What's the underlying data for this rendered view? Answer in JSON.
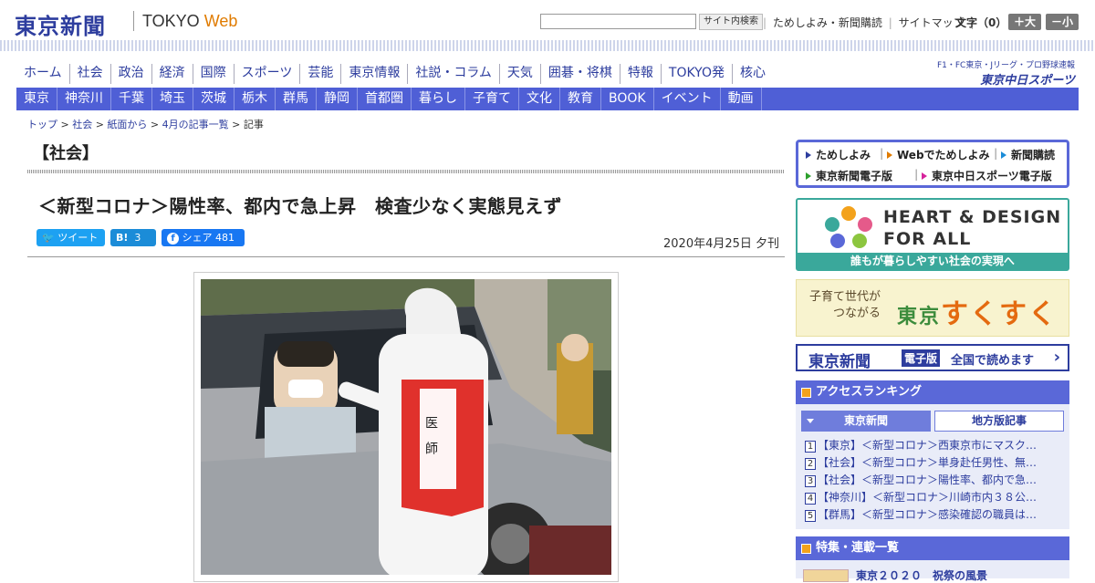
{
  "site": {
    "logo": "東京新聞",
    "web_brand": "TOKYO",
    "web_brand_accent": "Web"
  },
  "header": {
    "search_button": "サイト内検索",
    "links": [
      "ためしよみ・新聞購読",
      "サイトマップ"
    ],
    "font_size_label": "文字（0）",
    "font_bigger": "＋大",
    "font_smaller": "－小"
  },
  "nav_primary": [
    "ホーム",
    "社会",
    "政治",
    "経済",
    "国際",
    "スポーツ",
    "芸能",
    "東京情報",
    "社説・コラム",
    "天気",
    "囲碁・将棋",
    "特報",
    "TOKYO発",
    "核心"
  ],
  "chunichi": {
    "small": "F1・FC東京・Jリーグ・プロ野球速報",
    "big": "東京中日スポーツ"
  },
  "nav_regions": [
    "東京",
    "神奈川",
    "千葉",
    "埼玉",
    "茨城",
    "栃木",
    "群馬",
    "静岡",
    "首都圏",
    "暮らし",
    "子育て",
    "文化",
    "教育",
    "BOOK",
    "イベント",
    "動画"
  ],
  "breadcrumb": {
    "items": [
      "トップ",
      "社会",
      "紙面から",
      "4月の記事一覧",
      "記事"
    ],
    "separator": " > "
  },
  "article": {
    "section": "【社会】",
    "headline": "＜新型コロナ＞陽性率、都内で急上昇　検査少なく実態見えず",
    "date": "2020年4月25日 夕刊",
    "share": {
      "tweet": "ツイート",
      "hatena_label": "B!",
      "hatena_count": "3",
      "facebook": "シェア",
      "facebook_count": "481"
    },
    "photo_vest_text": "医　師"
  },
  "sidebar": {
    "promo": {
      "trial": "ためしよみ",
      "web_trial": "Webでためしよみ",
      "subscribe": "新聞購読",
      "e_edition": "東京新聞電子版",
      "chunichi_e": "東京中日スポーツ電子版"
    },
    "heart": {
      "line1": "HEART & DESIGN",
      "line2": "FOR ALL",
      "bar": "誰もが暮らしやすい社会の実現へ"
    },
    "kosodate": {
      "line1": "子育て世代が",
      "line2": "つながる",
      "brand_tokyo": "東京",
      "brand": "すくすく"
    },
    "denshi": {
      "name": "東京新聞",
      "badge": "電子版",
      "text": "全国で読めます",
      "chevron": "›"
    },
    "ranking": {
      "title": "アクセスランキング",
      "tab_active": "東京新聞",
      "tab_other": "地方版記事",
      "items": [
        {
          "num": "1",
          "text": "【東京】＜新型コロナ＞西東京市にマスク…"
        },
        {
          "num": "2",
          "text": "【社会】＜新型コロナ＞単身赴任男性、無…"
        },
        {
          "num": "3",
          "text": "【社会】＜新型コロナ＞陽性率、都内で急…"
        },
        {
          "num": "4",
          "text": "【神奈川】＜新型コロナ＞川崎市内３８公…"
        },
        {
          "num": "5",
          "text": "【群馬】＜新型コロナ＞感染確認の職員は…"
        }
      ]
    },
    "features": {
      "title": "特集・連載一覧",
      "first": "東京２０２０　祝祭の風景"
    }
  },
  "colors": {
    "brand_blue": "#2d3d9e",
    "nav_blue": "#4f5fd6",
    "accent_orange": "#e07b00",
    "teal": "#3aa89b"
  }
}
